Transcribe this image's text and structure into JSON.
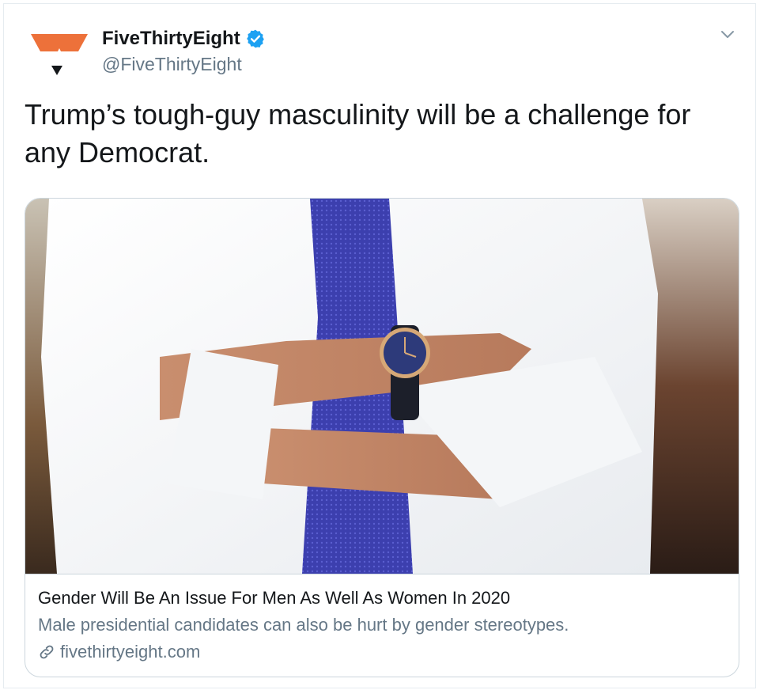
{
  "author": {
    "display_name": "FiveThirtyEight",
    "handle": "@FiveThirtyEight",
    "verified": true,
    "avatar_icon": "fivethirtyeight-logo-icon"
  },
  "tweet": {
    "text": "Trump’s tough-guy masculinity will be a challenge for any Democrat."
  },
  "menu": {
    "icon": "chevron-down-icon"
  },
  "card": {
    "image_icon": "man-crossed-arms-photo",
    "title": "Gender Will Be An Issue For Men As Well As Women In 2020",
    "description": "Male presidential candidates can also be hurt by gender stereotypes.",
    "domain": "fivethirtyeight.com",
    "link_icon": "link-icon"
  },
  "colors": {
    "logo_orange": "#ed713a",
    "verified_blue": "#1da1f2",
    "secondary_text": "#657786"
  }
}
